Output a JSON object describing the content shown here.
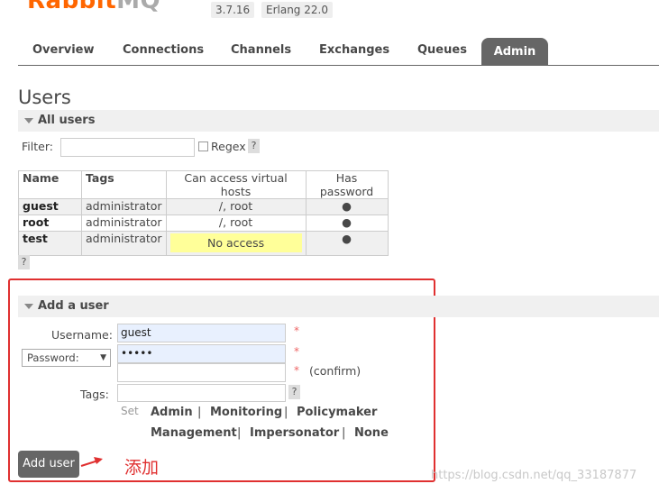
{
  "header": {
    "logo_part1": "Rabbit",
    "logo_part2": "MQ",
    "version": "3.7.16",
    "erlang": "Erlang 22.0"
  },
  "nav": {
    "tabs": [
      "Overview",
      "Connections",
      "Channels",
      "Exchanges",
      "Queues",
      "Admin"
    ],
    "active": "Admin"
  },
  "page_title": "Users",
  "all_users": {
    "section_label": "All users",
    "filter_label": "Filter:",
    "filter_value": "",
    "regex_label": "Regex",
    "help": "?",
    "columns": [
      "Name",
      "Tags",
      "Can access virtual hosts",
      "Has password"
    ],
    "rows": [
      {
        "name": "guest",
        "tags": "administrator",
        "vhosts": "/, root",
        "has_password": "●"
      },
      {
        "name": "root",
        "tags": "administrator",
        "vhosts": "/, root",
        "has_password": "●"
      },
      {
        "name": "test",
        "tags": "administrator",
        "vhosts": "No access",
        "has_password": "●"
      }
    ],
    "table_help": "?"
  },
  "add_user": {
    "section_label": "Add a user",
    "username_label": "Username:",
    "username_value": "guest",
    "password_select": "Password:",
    "password_value": "•••••",
    "confirm_label": "(confirm)",
    "required_mark": "*",
    "tags_label": "Tags:",
    "tags_value": "",
    "tags_help": "?",
    "set_label": "Set",
    "tag_options": [
      "Admin",
      "Monitoring",
      "Policymaker",
      "Management",
      "Impersonator",
      "None"
    ],
    "separator": "|",
    "submit_label": "Add user"
  },
  "annotation": {
    "text": "添加",
    "color": "#e03030"
  },
  "watermark": "https://blog.csdn.net/qq_33187877",
  "colors": {
    "brand": "#ff6600",
    "tab_active_bg": "#666666",
    "no_access_bg": "#ffff99",
    "highlight_box": "#e03030"
  }
}
